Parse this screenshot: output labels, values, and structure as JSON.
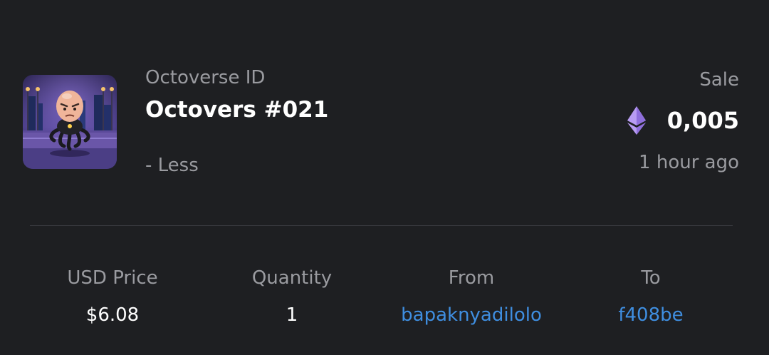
{
  "item": {
    "collection": "Octoverse ID",
    "name": "Octovers #021",
    "toggle_label": "- Less",
    "thumbnail_icon": "octopus-avatar-image"
  },
  "sale": {
    "event_label": "Sale",
    "currency_icon": "ethereum-icon",
    "price": "0,005",
    "time": "1 hour ago"
  },
  "stats": {
    "usd_price": {
      "label": "USD Price",
      "value": "$6.08"
    },
    "quantity": {
      "label": "Quantity",
      "value": "1"
    },
    "from": {
      "label": "From",
      "value": "bapaknyadilolo"
    },
    "to": {
      "label": "To",
      "value": "f408be"
    }
  },
  "colors": {
    "background": "#1e1f22",
    "primary_text": "#ffffff",
    "secondary_text": "#9a9ba0",
    "link": "#3f8ee0",
    "ethereum": "#9b7be0"
  }
}
